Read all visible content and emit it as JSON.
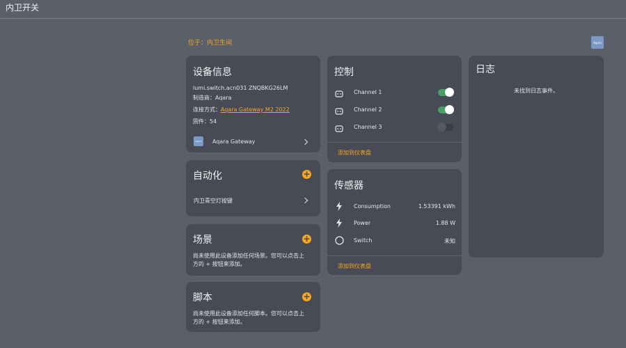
{
  "header": {
    "title": "内卫开关"
  },
  "location": "位于：内卫生间",
  "brand_tile": "Aqara",
  "device_info": {
    "title": "设备信息",
    "model": "lumi.switch.acn031 ZNQBKG26LM",
    "manufacturer": "制造商：Aqara",
    "connection_label": "连接方式：",
    "connection_link": "Aqara Gateway M2 2022",
    "firmware": "固件：54",
    "gateway_icon_text": "Aqara",
    "gateway_name": "Aqara Gateway"
  },
  "automation": {
    "title": "自动化",
    "item": "内卫青空灯按键"
  },
  "scene": {
    "title": "场景",
    "line1": "尚未使用此设备添加任何场景。您可以点击上",
    "line2": "方的 + 按钮来添加。"
  },
  "script": {
    "title": "脚本",
    "line1": "尚未使用此设备添加任何脚本。您可以点击上",
    "line2": "方的 + 按钮来添加。"
  },
  "control": {
    "title": "控制",
    "channels": [
      {
        "label": "Channel 1",
        "on": true
      },
      {
        "label": "Channel 2",
        "on": true
      },
      {
        "label": "Channel 3",
        "on": false
      }
    ],
    "add_to_dashboard": "添加到仪表盘"
  },
  "sensors": {
    "title": "传感器",
    "rows": [
      {
        "label": "Consumption",
        "value": "1.53391 kWh"
      },
      {
        "label": "Power",
        "value": "1.88 W"
      },
      {
        "label": "Switch",
        "value": "未知"
      }
    ],
    "add_to_dashboard": "添加到仪表盘"
  },
  "log": {
    "title": "日志",
    "empty": "未找到日志事件。"
  },
  "colors": {
    "accent": "#f5a623",
    "toggle_on": "#4b9e66",
    "card": "#484b55",
    "background": "#5b5f69"
  }
}
